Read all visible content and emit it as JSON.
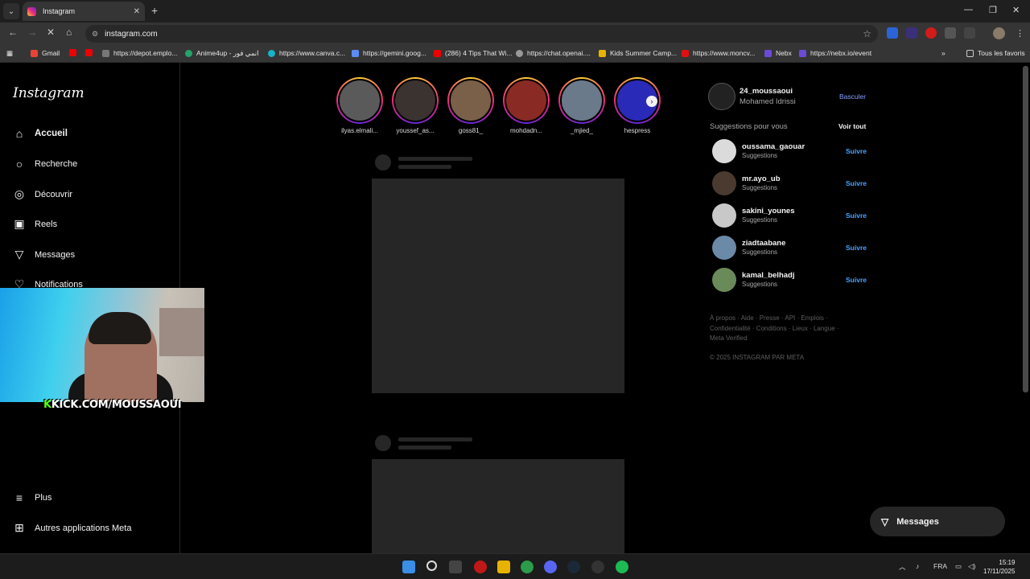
{
  "browser": {
    "tab_title": "Instagram",
    "url": "instagram.com",
    "bookmarks": [
      "Gmail",
      "https://depot.emplo...",
      "Anime4up - انمي فور",
      "https://www.canva.c...",
      "https://gemini.goog...",
      "(286) 4 Tips That Wi...",
      "https://chat.openai....",
      "Kids Summer Camp...",
      "https://www.moncv...",
      "Nebx",
      "https://nebx.io/event"
    ],
    "all_bookmarks": "Tous les favoris"
  },
  "sidebar": {
    "logo": "Instagram",
    "items": [
      {
        "label": "Accueil",
        "icon": "home-icon"
      },
      {
        "label": "Recherche",
        "icon": "search-icon"
      },
      {
        "label": "Découvrir",
        "icon": "compass-icon"
      },
      {
        "label": "Reels",
        "icon": "reels-icon"
      },
      {
        "label": "Messages",
        "icon": "messages-icon"
      },
      {
        "label": "Notifications",
        "icon": "heart-icon"
      },
      {
        "label": "Plus",
        "icon": "menu-icon"
      },
      {
        "label": "Autres applications Meta",
        "icon": "meta-apps-icon"
      }
    ]
  },
  "stories": [
    "ilyas.elmali...",
    "youssef_as...",
    "goss81_",
    "mohdadn...",
    "_mjied_",
    "hespress"
  ],
  "account": {
    "username": "24_moussaoui",
    "fullname": "Mohamed Idrissi",
    "switch": "Basculer"
  },
  "suggestions": {
    "title": "Suggestions pour vous",
    "see_all": "Voir tout",
    "follow": "Suivre",
    "items": [
      {
        "username": "oussama_gaouar",
        "sub": "Suggestions"
      },
      {
        "username": "mr.ayo_ub",
        "sub": "Suggestions"
      },
      {
        "username": "sakini_younes",
        "sub": "Suggestions"
      },
      {
        "username": "ziadtaabane",
        "sub": "Suggestions"
      },
      {
        "username": "kamal_belhadj",
        "sub": "Suggestions"
      }
    ]
  },
  "footer": {
    "links": "À propos · Aide · Presse · API · Emplois · Confidentialité · Conditions · Lieux · Langue · Meta Verified",
    "copyright": "© 2025 INSTAGRAM PAR META"
  },
  "messages_button": "Messages",
  "overlay": {
    "kick_k": "K",
    "kick_text": "KICK.COM/MOUSSAOUI"
  },
  "taskbar": {
    "lang": "FRA",
    "time": "15:19",
    "date": "17/11/2025"
  },
  "colors": {
    "accent": "#4aa3ff",
    "switch": "#85a1ff",
    "kick": "#53fc18"
  }
}
